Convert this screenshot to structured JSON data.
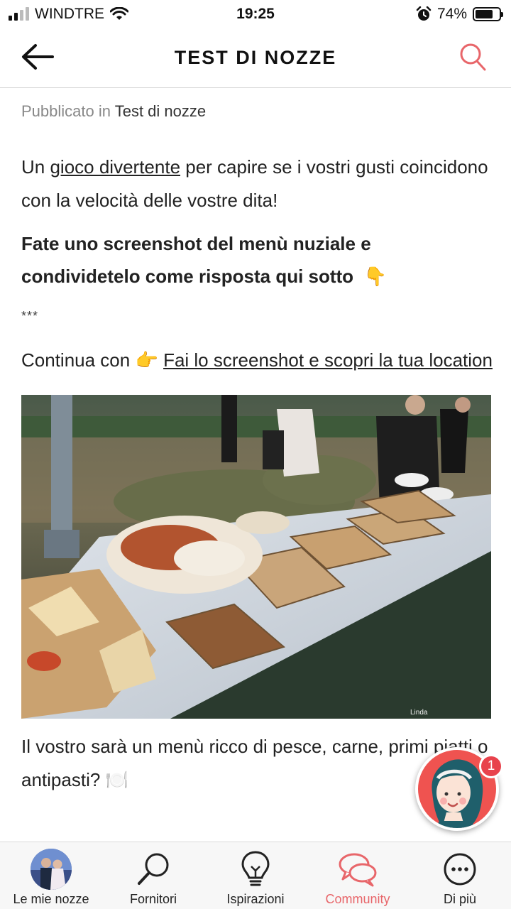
{
  "status": {
    "carrier": "WINDTRE",
    "time": "19:25",
    "battery_text": "74%",
    "battery_level": 0.74,
    "signal_bars_filled": 2,
    "signal_bars_total": 4
  },
  "header": {
    "title": "TEST DI NOZZE",
    "accent_color": "#e8666a"
  },
  "post": {
    "published_prefix": "Pubblicato in",
    "published_category": "Test di nozze",
    "intro_pre": "Un ",
    "intro_link": "gioco divertente",
    "intro_post": " per capire se i vostri gusti coincidono con la velocità delle vostre dita!",
    "bold_text": "Fate uno screenshot del menù nuziale e condividetelo come risposta qui sotto",
    "bold_emoji": "👇",
    "separator": "***",
    "continue_pre": "Continua con ",
    "continue_emoji": "👉",
    "continue_link": "Fai lo screenshot e scopri la tua location",
    "image_alt": "Buffet nuziale all'aperto",
    "question": "Il vostro sarà un menù ricco di pesce, carne, primi piatti o antipasti?",
    "question_emoji": "🍽️"
  },
  "fab": {
    "badge_count": "1",
    "color": "#ef5350"
  },
  "nav": {
    "items": [
      {
        "label": "Le mie nozze",
        "icon": "profile-photo-icon"
      },
      {
        "label": "Fornitori",
        "icon": "magnifier-icon"
      },
      {
        "label": "Ispirazioni",
        "icon": "lightbulb-icon"
      },
      {
        "label": "Community",
        "icon": "chat-bubbles-icon"
      },
      {
        "label": "Di più",
        "icon": "more-dots-icon"
      }
    ],
    "active_index": 3
  }
}
